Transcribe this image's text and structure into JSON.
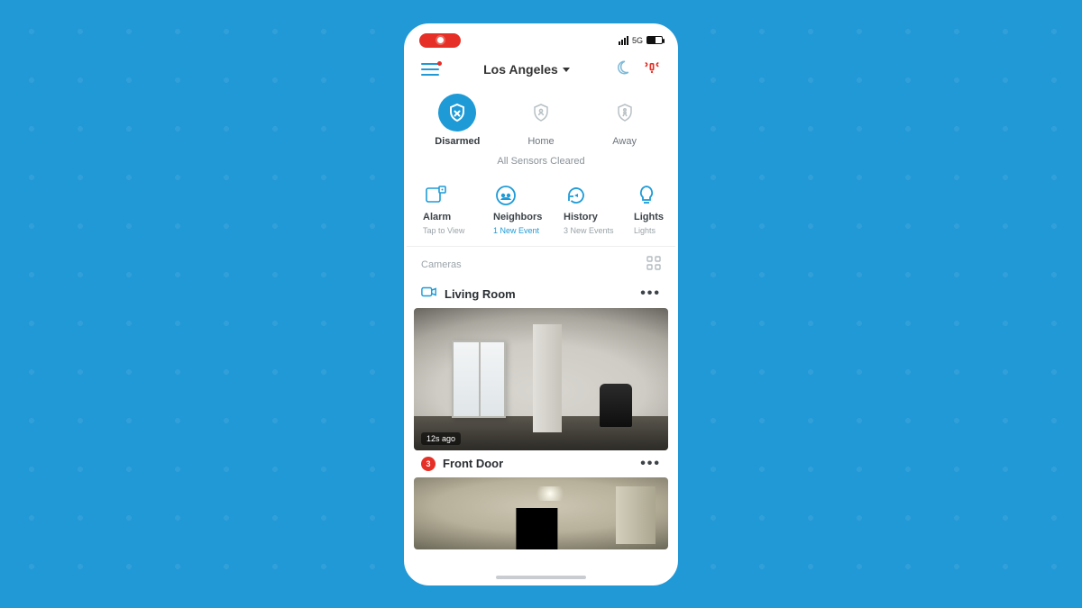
{
  "statusbar": {
    "network": "5G"
  },
  "header": {
    "location": "Los Angeles"
  },
  "modes": [
    {
      "key": "disarmed",
      "label": "Disarmed",
      "active": true
    },
    {
      "key": "home",
      "label": "Home",
      "active": false
    },
    {
      "key": "away",
      "label": "Away",
      "active": false
    }
  ],
  "sensor_status": "All Sensors Cleared",
  "tiles": [
    {
      "key": "alarm",
      "title": "Alarm",
      "sub": "Tap to View",
      "accent": false
    },
    {
      "key": "neighbors",
      "title": "Neighbors",
      "sub": "1 New Event",
      "accent": true
    },
    {
      "key": "history",
      "title": "History",
      "sub": "3 New Events",
      "accent": false
    },
    {
      "key": "lights",
      "title": "Lights",
      "sub": "Lights",
      "accent": false
    }
  ],
  "sections": {
    "cameras": "Cameras"
  },
  "cameras": [
    {
      "key": "living_room",
      "name": "Living Room",
      "timestamp": "12s ago",
      "badge": null
    },
    {
      "key": "front_door",
      "name": "Front Door",
      "timestamp": null,
      "badge": "3"
    }
  ]
}
